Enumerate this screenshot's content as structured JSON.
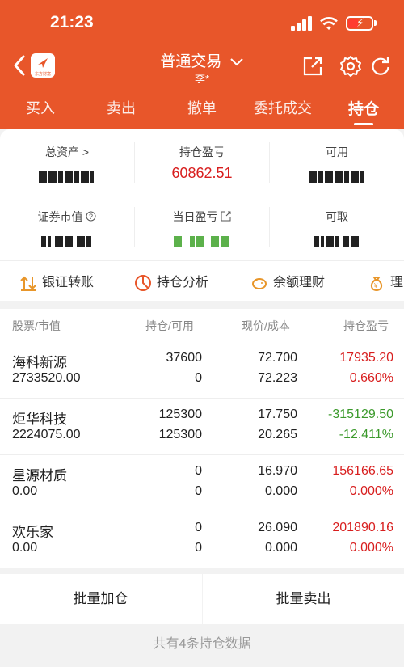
{
  "status": {
    "time": "21:23"
  },
  "header": {
    "title": "普通交易",
    "subtitle": "李*",
    "logo_text": "东方财富",
    "icons": [
      "back-icon",
      "share-icon",
      "gear-icon",
      "refresh-icon"
    ]
  },
  "tabs": [
    {
      "label": "买入"
    },
    {
      "label": "卖出"
    },
    {
      "label": "撤单"
    },
    {
      "label": "委托成交"
    },
    {
      "label": "持仓"
    }
  ],
  "summary": {
    "total_assets_label": "总资产 >",
    "position_pnl_label": "持仓盈亏",
    "position_pnl_value": "60862.51",
    "available_label": "可用",
    "market_value_label": "证券市值",
    "daily_pnl_label": "当日盈亏",
    "withdrawable_label": "可取"
  },
  "tools": [
    {
      "label": "银证转账",
      "icon": "transfer-icon"
    },
    {
      "label": "持仓分析",
      "icon": "pie-chart-icon"
    },
    {
      "label": "余额理财",
      "icon": "piggy-bank-icon"
    },
    {
      "label": "理",
      "icon": "money-bag-icon"
    }
  ],
  "table": {
    "headers": {
      "stock": "股票/市值",
      "holding": "持仓/可用",
      "price": "现价/成本",
      "pnl": "持仓盈亏"
    },
    "rows": [
      {
        "name": "海科新源",
        "value": "2733520.00",
        "holding": "37600",
        "available": "0",
        "price": "72.700",
        "cost": "72.223",
        "pnl": "17935.20",
        "pnl_pct": "0.660%",
        "trend": "up"
      },
      {
        "name": "炬华科技",
        "value": "2224075.00",
        "holding": "125300",
        "available": "125300",
        "price": "17.750",
        "cost": "20.265",
        "pnl": "-315129.50",
        "pnl_pct": "-12.411%",
        "trend": "down"
      },
      {
        "name": "星源材质",
        "value": "0.00",
        "holding": "0",
        "available": "0",
        "price": "16.970",
        "cost": "0.000",
        "pnl": "156166.65",
        "pnl_pct": "0.000%",
        "trend": "up"
      },
      {
        "name": "欢乐家",
        "value": "0.00",
        "holding": "0",
        "available": "0",
        "price": "26.090",
        "cost": "0.000",
        "pnl": "201890.16",
        "pnl_pct": "0.000%",
        "trend": "up"
      }
    ]
  },
  "actions": {
    "batch_add": "批量加仓",
    "batch_sell": "批量卖出"
  },
  "footer": {
    "text": "共有4条持仓数据"
  },
  "colors": {
    "brand": "#e8562a",
    "up": "#d81e1e",
    "down": "#3c9a2c"
  }
}
